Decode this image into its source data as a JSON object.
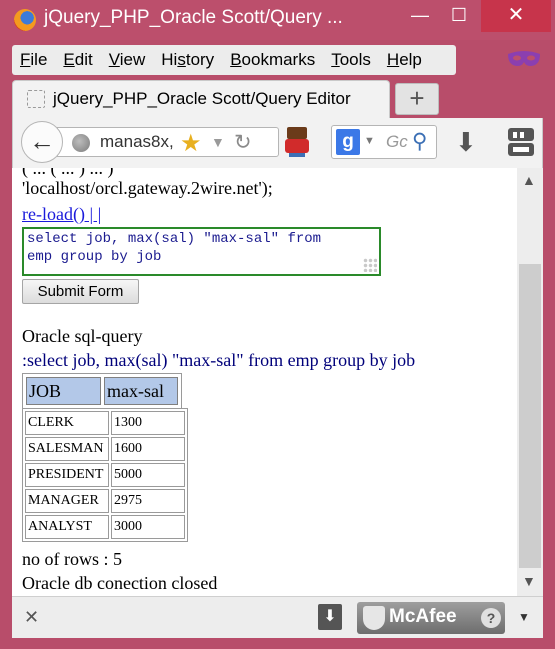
{
  "window": {
    "title": "jQuery_PHP_Oracle Scott/Query ...",
    "minimize": "—",
    "maximize": "☐",
    "close": "✕"
  },
  "menu": {
    "items": [
      {
        "label": "File",
        "underline": "F",
        "rest": "ile"
      },
      {
        "label": "Edit",
        "underline": "E",
        "rest": "dit"
      },
      {
        "label": "View",
        "underline": "V",
        "rest": "iew"
      },
      {
        "label": "History",
        "underline": "s",
        "prefix": "Hi",
        "rest": "tory"
      },
      {
        "label": "Bookmarks",
        "underline": "B",
        "rest": "ookmarks"
      },
      {
        "label": "Tools",
        "underline": "T",
        "rest": "ools"
      },
      {
        "label": "Help",
        "underline": "H",
        "rest": "elp"
      }
    ]
  },
  "tabs": {
    "active_title": "jQuery_PHP_Oracle Scott/Query Editor",
    "new_tab": "+"
  },
  "navbar": {
    "url_text": "manas8x,",
    "search_placeholder": "Gc",
    "search_engine": "g"
  },
  "page": {
    "cut_line": "( ... ( ... ) ... )",
    "host_line": "'localhost/orcl.gateway.2wire.net');",
    "reload_link": "re-load()",
    "reload_sep": " | |",
    "query_text": "select job, max(sal) \"max-sal\" from\nemp group by job",
    "submit_label": "Submit Form",
    "oracle_heading": "Oracle sql-query",
    "query_echo": ":select job, max(sal) \"max-sal\" from emp group by job",
    "columns": [
      "JOB",
      "max-sal"
    ],
    "rows": [
      [
        "CLERK",
        "1300"
      ],
      [
        "SALESMAN",
        "1600"
      ],
      [
        "PRESIDENT",
        "5000"
      ],
      [
        "MANAGER",
        "2975"
      ],
      [
        "ANALYST",
        "3000"
      ]
    ],
    "row_count": "no of rows : 5",
    "closed_msg": "Oracle db conection closed"
  },
  "addon_bar": {
    "close": "✕",
    "mcafee_label": "McAfee",
    "help": "?"
  }
}
